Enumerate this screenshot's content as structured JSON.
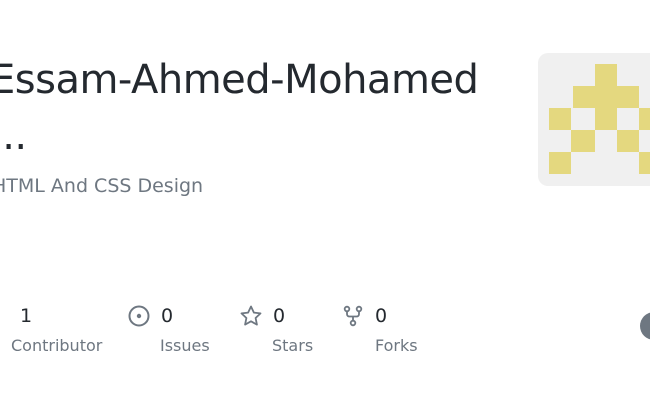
{
  "repo": {
    "title_line1": "Essam-Ahmed-Mohamed",
    "title_line2": "...",
    "description": "HTML And CSS Design"
  },
  "stats": [
    {
      "value": "1",
      "label": "Contributor",
      "icon": "people-icon"
    },
    {
      "value": "0",
      "label": "Issues",
      "icon": "issue-icon"
    },
    {
      "value": "0",
      "label": "Stars",
      "icon": "star-icon"
    },
    {
      "value": "0",
      "label": "Forks",
      "icon": "fork-icon"
    }
  ],
  "colors": {
    "identicon": "#e4d87f",
    "text_primary": "#24292f",
    "text_muted": "#6e7781"
  }
}
